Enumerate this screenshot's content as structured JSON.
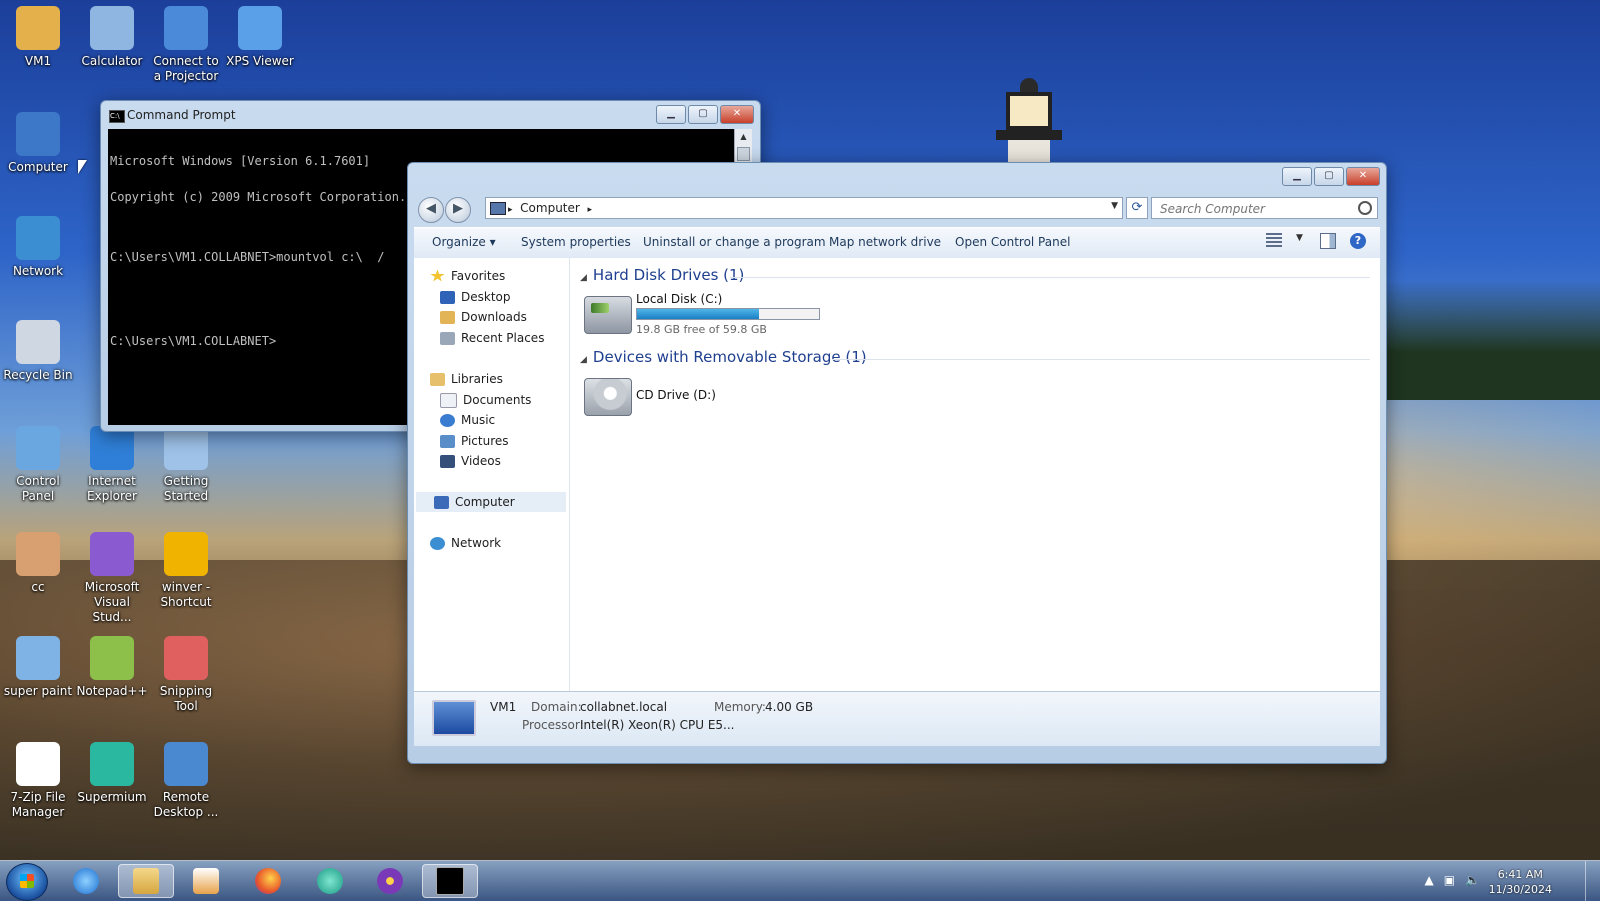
{
  "desktop": {
    "icons": [
      {
        "label": "VM1",
        "icon": "user-folder-icon",
        "color": "#e3b04b"
      },
      {
        "label": "Calculator",
        "icon": "calculator-icon",
        "color": "#8fb6e0"
      },
      {
        "label": "Connect to a Projector",
        "icon": "projector-icon",
        "color": "#4a8ad8"
      },
      {
        "label": "XPS Viewer",
        "icon": "xps-viewer-icon",
        "color": "#5aa0e8"
      },
      {
        "label": "Computer",
        "icon": "computer-icon",
        "color": "#3d78c8"
      },
      {
        "label": "Network",
        "icon": "network-icon",
        "color": "#3c8ed2"
      },
      {
        "label": "Recycle Bin",
        "icon": "recycle-bin-icon",
        "color": "#cfd8e2"
      },
      {
        "label": "Control Panel",
        "icon": "control-panel-icon",
        "color": "#6aa6e0"
      },
      {
        "label": "Internet Explorer",
        "icon": "internet-explorer-icon",
        "color": "#2f7fd8"
      },
      {
        "label": "Getting Started",
        "icon": "getting-started-icon",
        "color": "#9ec2e8"
      },
      {
        "label": "cc",
        "icon": "image-file-icon",
        "color": "#d8a070"
      },
      {
        "label": "Microsoft Visual Stud...",
        "icon": "visual-studio-icon",
        "color": "#8a5bd0"
      },
      {
        "label": "winver - Shortcut",
        "icon": "windows-logo-icon",
        "color": "#f0b400"
      },
      {
        "label": "super paint",
        "icon": "paint-icon",
        "color": "#7fb3e6"
      },
      {
        "label": "Notepad++",
        "icon": "notepad-plus-plus-icon",
        "color": "#8cc04a"
      },
      {
        "label": "Snipping Tool",
        "icon": "scissors-icon",
        "color": "#e06060"
      },
      {
        "label": "7-Zip File Manager",
        "icon": "seven-zip-icon",
        "color": "#ffffff"
      },
      {
        "label": "Supermium",
        "icon": "supermium-icon",
        "color": "#2ab8a0"
      },
      {
        "label": "Remote Desktop ...",
        "icon": "remote-desktop-icon",
        "color": "#4a88d0"
      }
    ]
  },
  "cmd": {
    "title": "Command Prompt",
    "lines": [
      "Microsoft Windows [Version 6.1.7601]",
      "Copyright (c) 2009 Microsoft Corporation.  All rights reserved.",
      "",
      "C:\\Users\\VM1.COLLABNET>mountvol c:\\  /",
      "",
      "",
      "C:\\Users\\VM1.COLLABNET>"
    ]
  },
  "explorer": {
    "breadcrumb": "Computer",
    "search_placeholder": "Search Computer",
    "toolbar": {
      "organize": "Organize ▾",
      "system_properties": "System properties",
      "uninstall": "Uninstall or change a program",
      "map_drive": "Map network drive",
      "control_panel": "Open Control Panel"
    },
    "nav": {
      "favorites": "Favorites",
      "desktop": "Desktop",
      "downloads": "Downloads",
      "recent": "Recent Places",
      "libraries": "Libraries",
      "documents": "Documents",
      "music": "Music",
      "pictures": "Pictures",
      "videos": "Videos",
      "computer": "Computer",
      "network": "Network"
    },
    "groups": {
      "hdd": "Hard Disk Drives (1)",
      "removable": "Devices with Removable Storage (1)"
    },
    "drives": {
      "c_name": "Local Disk (C:)",
      "c_free": "19.8 GB free of 59.8 GB",
      "c_used_fraction": 0.67,
      "d_name": "CD Drive (D:)"
    },
    "details": {
      "name": "VM1",
      "domain_label": "Domain:",
      "domain": "collabnet.local",
      "memory_label": "Memory:",
      "memory": "4.00 GB",
      "processor_label": "Processor:",
      "processor": "Intel(R) Xeon(R) CPU E5..."
    }
  },
  "taskbar": {
    "time": "6:41 AM",
    "date": "11/30/2024",
    "apps": [
      "internet-explorer-icon",
      "windows-explorer-icon",
      "media-player-icon",
      "firefox-icon",
      "supermium-icon",
      "tor-icon",
      "command-prompt-icon"
    ]
  }
}
